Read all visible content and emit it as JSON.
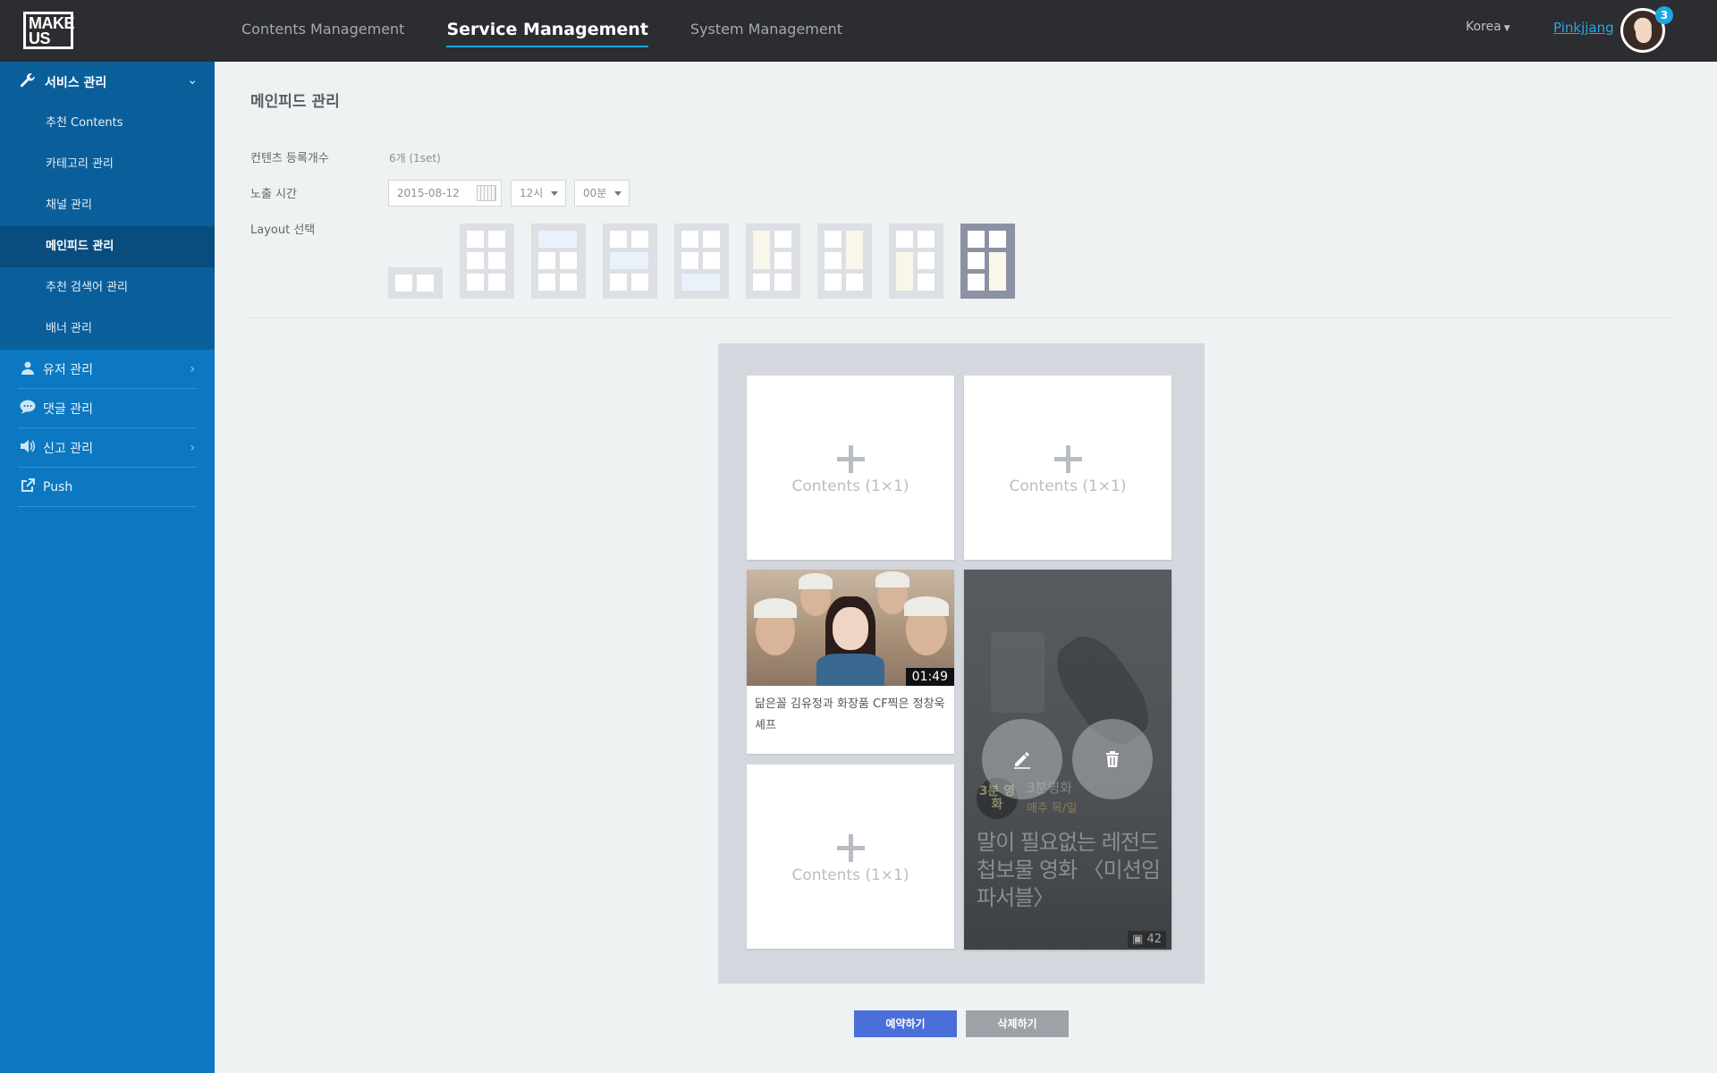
{
  "header": {
    "logo_text": "MAKE US",
    "tabs": [
      {
        "label": "Contents Management"
      },
      {
        "label": "Service Management"
      },
      {
        "label": "System Management"
      }
    ],
    "region": "Korea",
    "username": "Pinkjjang",
    "notification_count": "3"
  },
  "sidebar": {
    "section_title": "서비스 관리",
    "sub_items": [
      {
        "label": "추천 Contents"
      },
      {
        "label": "카테고리 관리"
      },
      {
        "label": "채널 관리"
      },
      {
        "label": "메인피드 관리"
      },
      {
        "label": "추천 검색어 관리"
      },
      {
        "label": "배너 관리"
      }
    ],
    "menu": [
      {
        "label": "유저 관리"
      },
      {
        "label": "댓글 관리"
      },
      {
        "label": "신고 관리"
      },
      {
        "label": "Push"
      }
    ]
  },
  "main": {
    "title": "메인피드 관리",
    "count_label": "컨텐츠 등록개수",
    "count_value": "6개 (1set)",
    "time_label": "노출 시간",
    "date_value": "2015-08-12",
    "hour_value": "12시",
    "minute_value": "00분",
    "layout_label": "Layout 선택",
    "slot_label": "Contents (1×1)",
    "video": {
      "duration": "01:49",
      "title": "닮은꼴 김유정과 화장품 CF찍은 정창욱 셰프"
    },
    "feature": {
      "badge": "3분 영화",
      "channel": "3분영화",
      "schedule": "매주 목/일",
      "title": "말이 필요없는 레전드 첩보물 영화 〈미션임파서블〉",
      "image_count": "42"
    },
    "reserve_button": "예약하기",
    "delete_button": "삭제하기"
  },
  "colors": {
    "topbar": "#2b2d30",
    "sidebar": "#0b78c1",
    "accent": "#1ea7e1",
    "primary_button": "#4a6fd8"
  }
}
